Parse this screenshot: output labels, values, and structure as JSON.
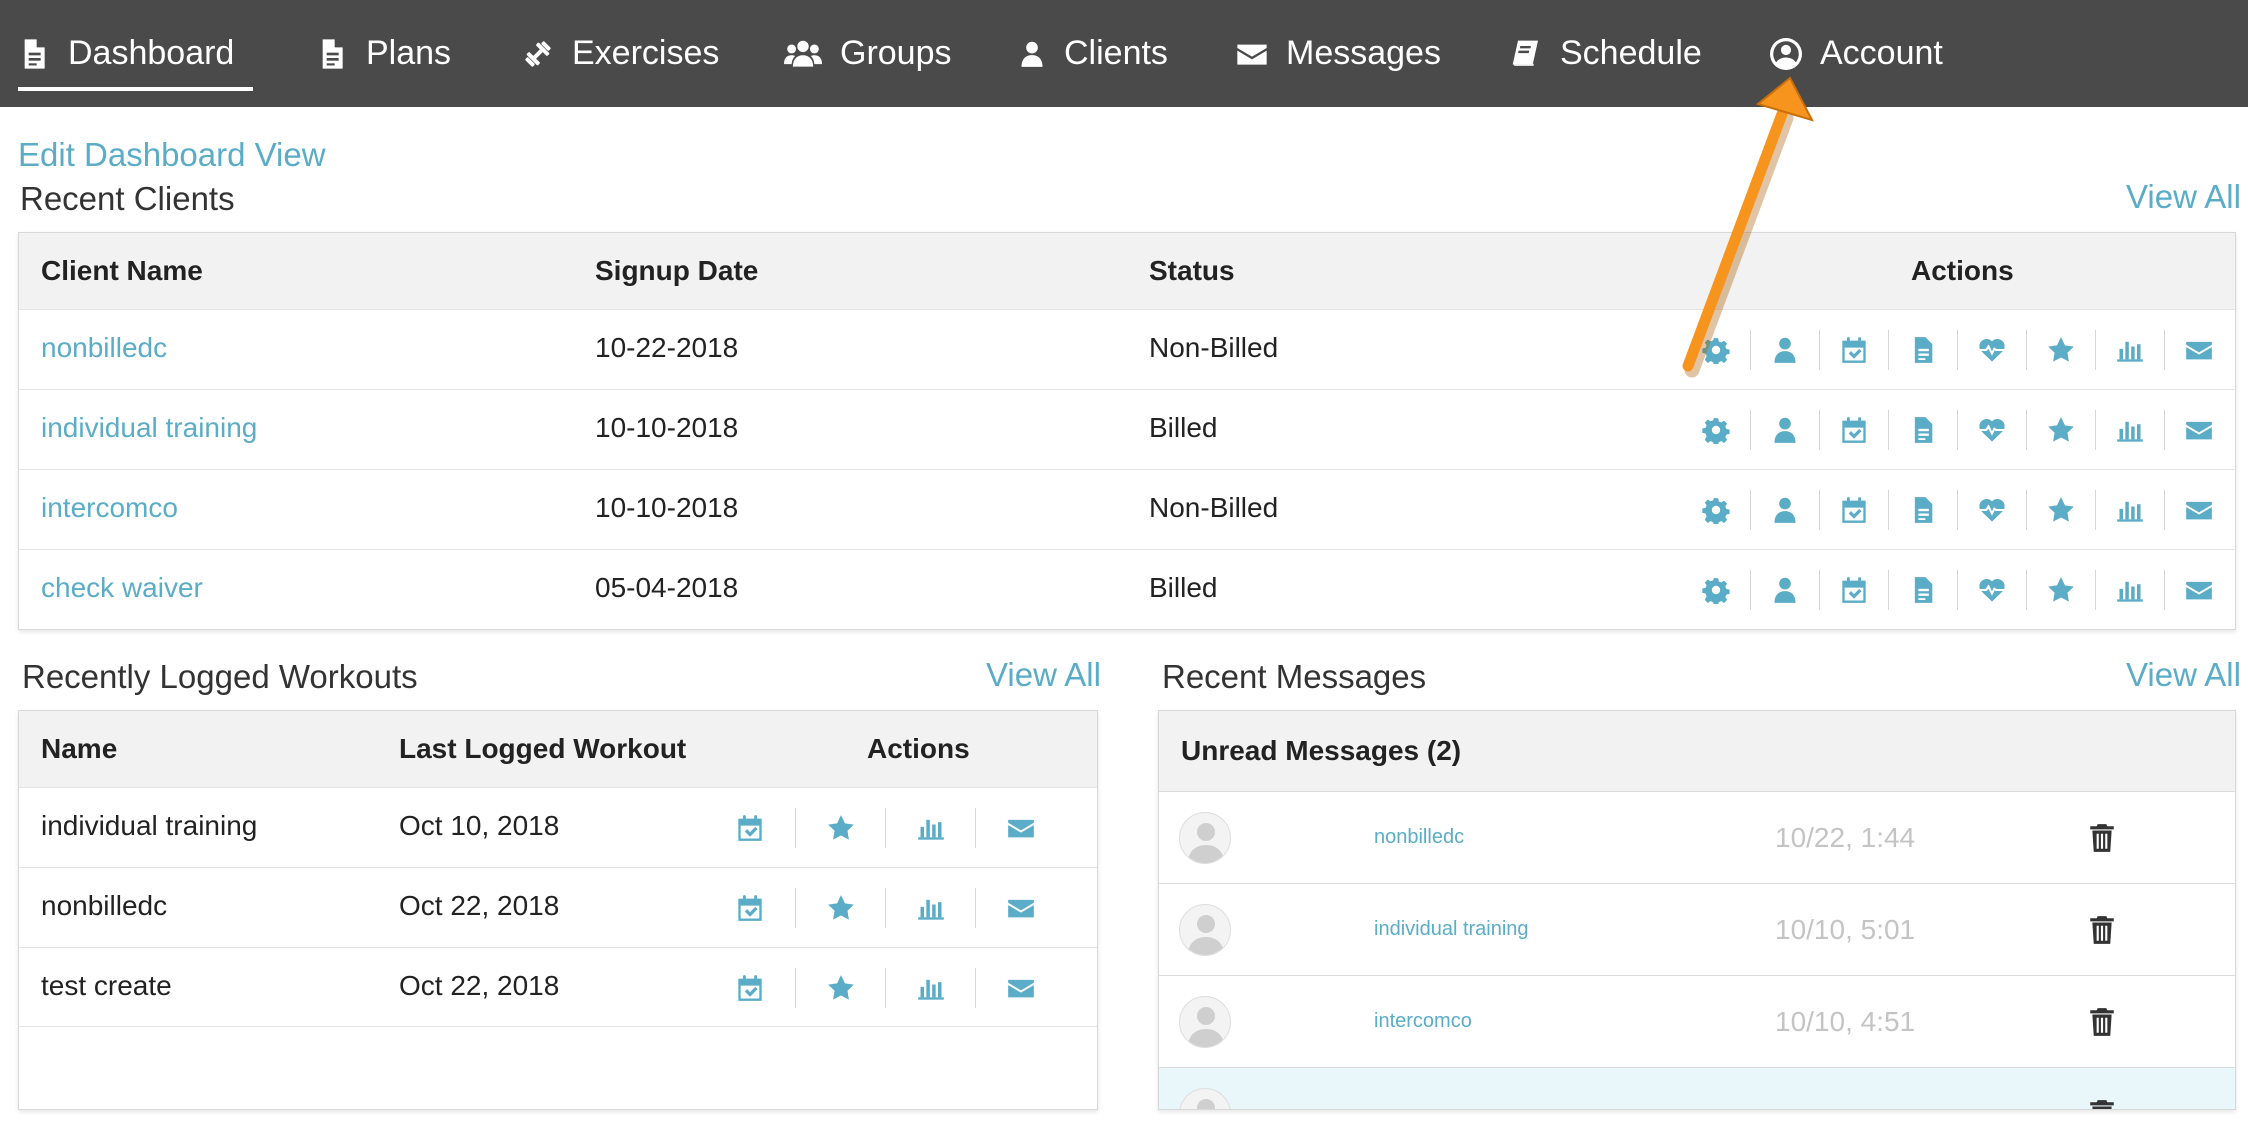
{
  "nav": {
    "items": [
      {
        "label": "Dashboard",
        "icon": "document-icon",
        "active": true
      },
      {
        "label": "Plans",
        "icon": "document-icon"
      },
      {
        "label": "Exercises",
        "icon": "dumbbell-icon"
      },
      {
        "label": "Groups",
        "icon": "users-icon"
      },
      {
        "label": "Clients",
        "icon": "user-icon"
      },
      {
        "label": "Messages",
        "icon": "envelope-icon"
      },
      {
        "label": "Schedule",
        "icon": "book-icon"
      },
      {
        "label": "Account",
        "icon": "user-circle-icon"
      }
    ]
  },
  "edit_dashboard": "Edit Dashboard View",
  "recent_clients": {
    "title": "Recent Clients",
    "view_all": "View All",
    "columns": [
      "Client Name",
      "Signup Date",
      "Status",
      "Actions"
    ],
    "rows": [
      {
        "name": "nonbilledc",
        "signup": "10-22-2018",
        "status": "Non-Billed"
      },
      {
        "name": "individual training",
        "signup": "10-10-2018",
        "status": "Billed"
      },
      {
        "name": "intercomco",
        "signup": "10-10-2018",
        "status": "Non-Billed"
      },
      {
        "name": "check waiver",
        "signup": "05-04-2018",
        "status": "Billed"
      }
    ],
    "action_icons": [
      "gear-icon",
      "user-icon",
      "calendar-check-icon",
      "document-icon",
      "heartbeat-icon",
      "star-icon",
      "bar-chart-icon",
      "envelope-icon"
    ]
  },
  "workouts": {
    "title": "Recently Logged Workouts",
    "view_all": "View All",
    "columns": [
      "Name",
      "Last Logged Workout",
      "Actions"
    ],
    "rows": [
      {
        "name": "individual training",
        "date": "Oct 10, 2018"
      },
      {
        "name": "nonbilledc",
        "date": "Oct 22, 2018"
      },
      {
        "name": "test create",
        "date": "Oct 22, 2018"
      }
    ],
    "action_icons": [
      "calendar-check-icon",
      "star-icon",
      "bar-chart-icon",
      "envelope-icon"
    ]
  },
  "messages": {
    "title": "Recent Messages",
    "view_all": "View All",
    "header": "Unread Messages (2)",
    "rows": [
      {
        "name": "nonbilledc",
        "time": "10/22, 1:44"
      },
      {
        "name": "individual training",
        "time": "10/10, 5:01"
      },
      {
        "name": "intercomco",
        "time": "10/10, 4:51"
      },
      {
        "name": "",
        "time": ""
      }
    ]
  },
  "colors": {
    "nav_bg": "#4a4a4a",
    "accent": "#5aacc7",
    "annotation_arrow": "#f7941d"
  }
}
